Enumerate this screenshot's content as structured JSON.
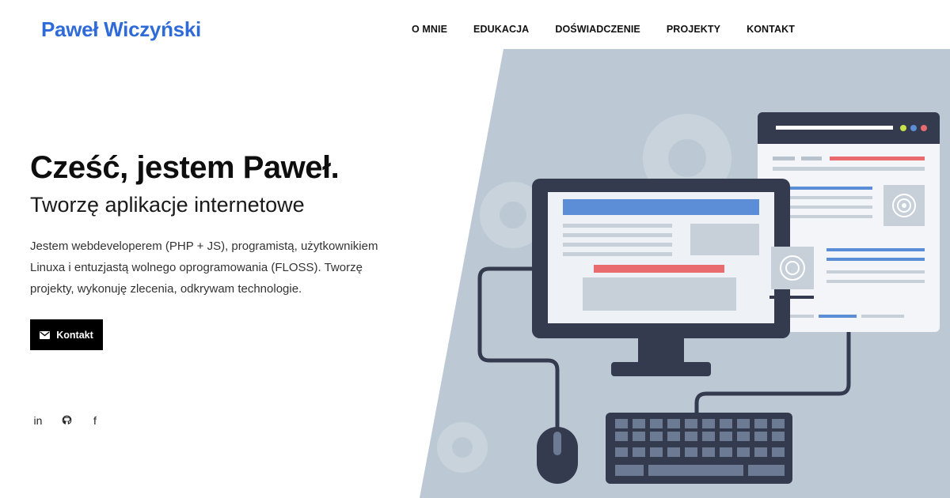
{
  "header": {
    "logo": "Paweł Wiczyński",
    "nav": [
      "O MNIE",
      "EDUKACJA",
      "DOŚWIADCZENIE",
      "PROJEKTY",
      "KONTAKT"
    ]
  },
  "hero": {
    "title": "Cześć, jestem Paweł.",
    "subtitle": "Tworzę aplikacje internetowe",
    "description": "Jestem webdeveloperem (PHP + JS), programistą, użytkownikiem Linuxa i entuzjastą wolnego oprogramowania (FLOSS). Tworzę projekty, wykonuję zlecenia, odkrywam technologie.",
    "cta": {
      "label": "Kontakt",
      "icon": "mail-icon"
    }
  },
  "social": [
    {
      "name": "linkedin-icon",
      "glyph": "in"
    },
    {
      "name": "github-icon",
      "glyph": ""
    },
    {
      "name": "facebook-icon",
      "glyph": "f"
    }
  ],
  "colors": {
    "brand": "#2f6bd8",
    "art_background": "#bcc8d4",
    "art_dark": "#343b4f",
    "art_accent_blue": "#5b8ed6",
    "art_accent_red": "#e96b6f"
  }
}
